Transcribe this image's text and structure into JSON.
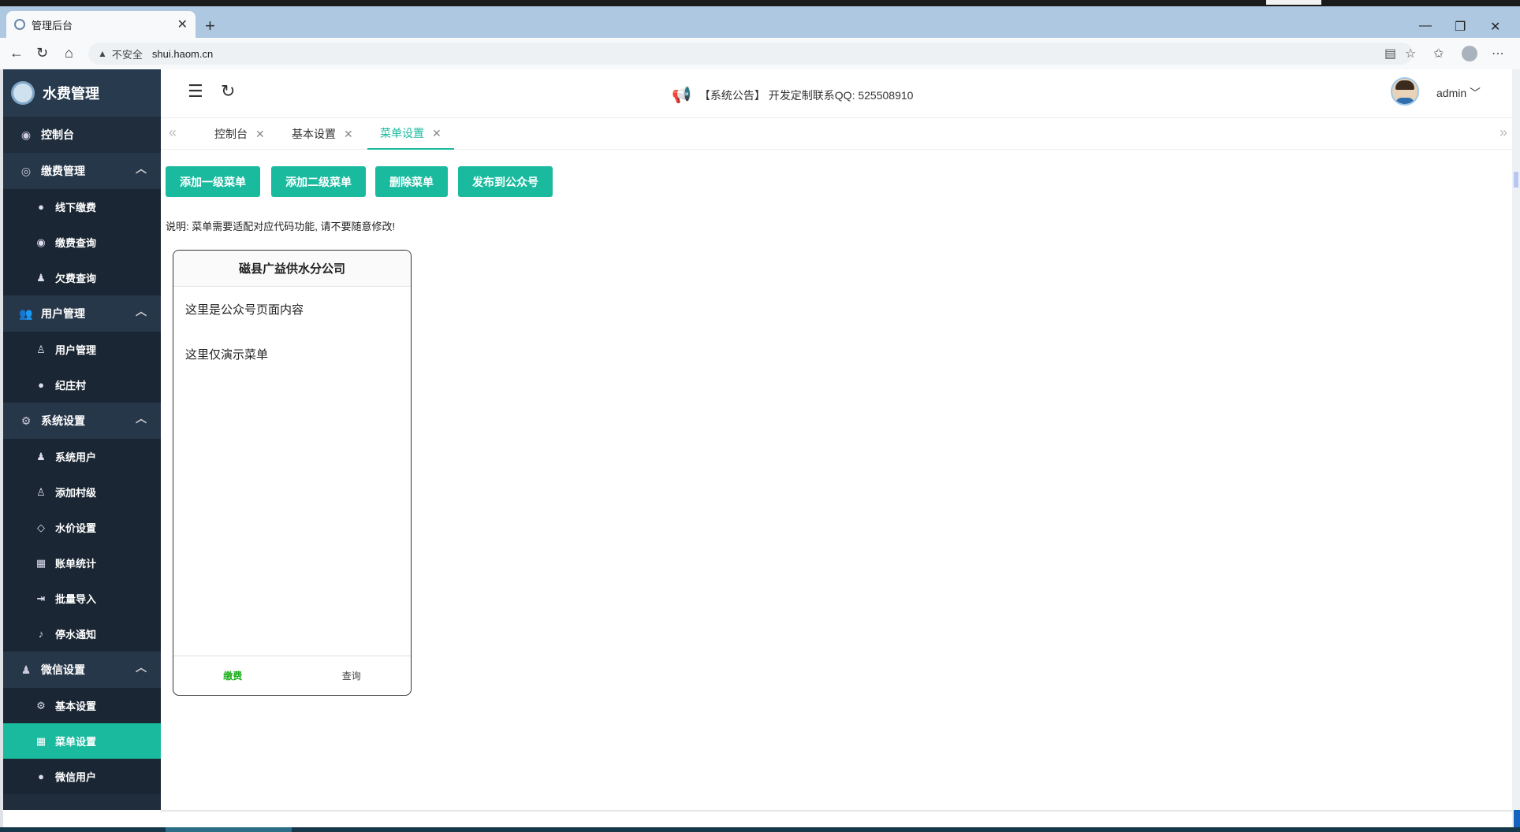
{
  "browser": {
    "tab_title": "管理后台",
    "tab_close": "✕",
    "new_tab": "+",
    "insecure_label": "不安全",
    "url": "shui.haom.cn"
  },
  "sidebar": {
    "logo_text": "水费管理",
    "dashboard": "控制台",
    "groups": [
      {
        "label": "缴费管理",
        "items": [
          "线下缴费",
          "缴费查询",
          "欠费查询"
        ]
      },
      {
        "label": "用户管理",
        "items": [
          "用户管理",
          "纪庄村"
        ]
      },
      {
        "label": "系统设置",
        "items": [
          "系统用户",
          "添加村级",
          "水价设置",
          "账单统计",
          "批量导入",
          "停水通知"
        ]
      },
      {
        "label": "微信设置",
        "items": [
          "基本设置",
          "菜单设置",
          "微信用户"
        ]
      }
    ],
    "active_item": "菜单设置"
  },
  "header": {
    "notice": "【系统公告】 开发定制联系QQ: 525508910",
    "user": "admin"
  },
  "tabs": [
    "控制台",
    "基本设置",
    "菜单设置"
  ],
  "active_tab": "菜单设置",
  "toolbar": {
    "add_level1": "添加一级菜单",
    "add_level2": "添加二级菜单",
    "delete": "删除菜单",
    "publish": "发布到公众号"
  },
  "description": "说明: 菜单需要适配对应代码功能, 请不要随意修改!",
  "phone": {
    "title": "磁县广益供水分公司",
    "line1": "这里是公众号页面内容",
    "line2": "这里仅演示菜单",
    "menu": [
      "缴费",
      "查询"
    ]
  },
  "colors": {
    "accent": "#1aba9f",
    "sidebar_bg": "#1f2d3d",
    "menu_active": "#1aad19"
  }
}
